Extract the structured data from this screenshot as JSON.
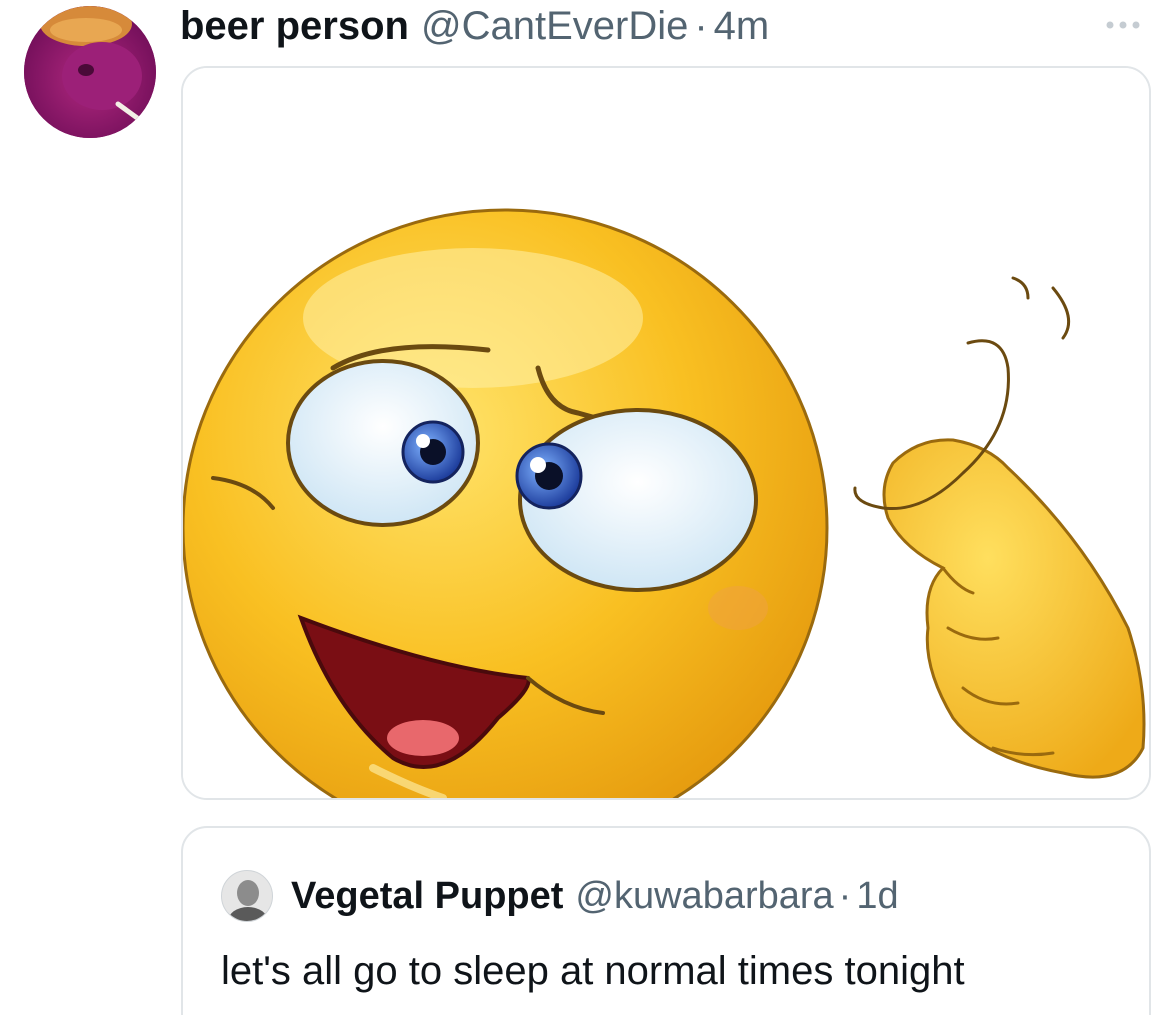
{
  "tweet": {
    "display_name": "beer person",
    "handle": "@CantEverDie",
    "separator": "·",
    "time": "4m",
    "more_icon": "ellipsis-icon",
    "media_description": "thinking emoji tapping head image"
  },
  "quote": {
    "display_name": "Vegetal Puppet",
    "handle": "@kuwabarbara",
    "separator": "·",
    "time": "1d",
    "text": "let's all go to sleep at normal times tonight"
  },
  "colors": {
    "text_primary": "#0f1419",
    "text_secondary": "#536471",
    "border": "#e1e5e8",
    "emoji_yellow": "#f9c022"
  }
}
